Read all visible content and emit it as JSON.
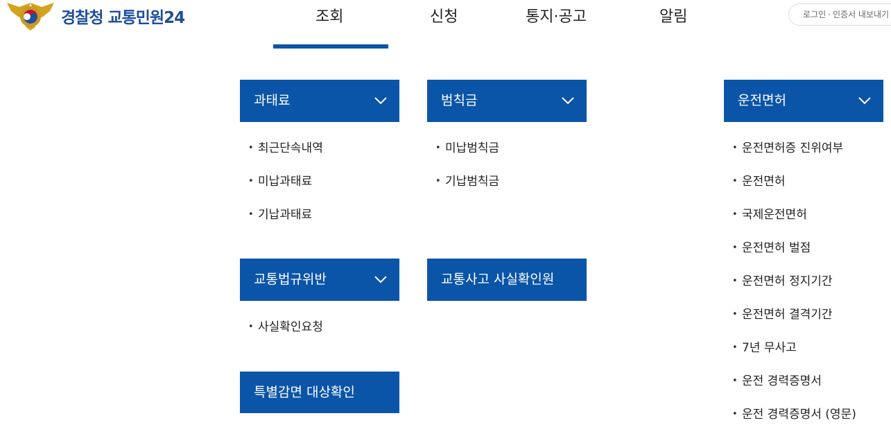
{
  "header": {
    "logo_text": "경찰청 교통민원24",
    "nav": [
      "조회",
      "신청",
      "통지·공고",
      "알림"
    ],
    "util": {
      "login": "로그인",
      "separator": "·",
      "cert": "인증서 내보내기"
    }
  },
  "menu": {
    "fine": {
      "title": "과태료",
      "items": [
        "최근단속내역",
        "미납과태료",
        "기납과태료"
      ]
    },
    "penalty": {
      "title": "범칙금",
      "items": [
        "미납범칙금",
        "기납범칙금"
      ]
    },
    "license": {
      "title": "운전면허",
      "items": [
        "운전면허증 진위여부",
        "운전면허",
        "국제운전면허",
        "운전면허 벌점",
        "운전면허 정지기간",
        "운전면허 결격기간",
        "7년 무사고",
        "운전 경력증명서",
        "운전 경력증명서 (영문)"
      ]
    },
    "violation": {
      "title": "교통법규위반",
      "items": [
        "사실확인요청"
      ]
    },
    "accident": {
      "title": "교통사고 사실확인원"
    },
    "special": {
      "title": "특별감면 대상확인"
    }
  },
  "colors": {
    "brand": "#0b55a8",
    "logo_text": "#1f4e9c"
  }
}
